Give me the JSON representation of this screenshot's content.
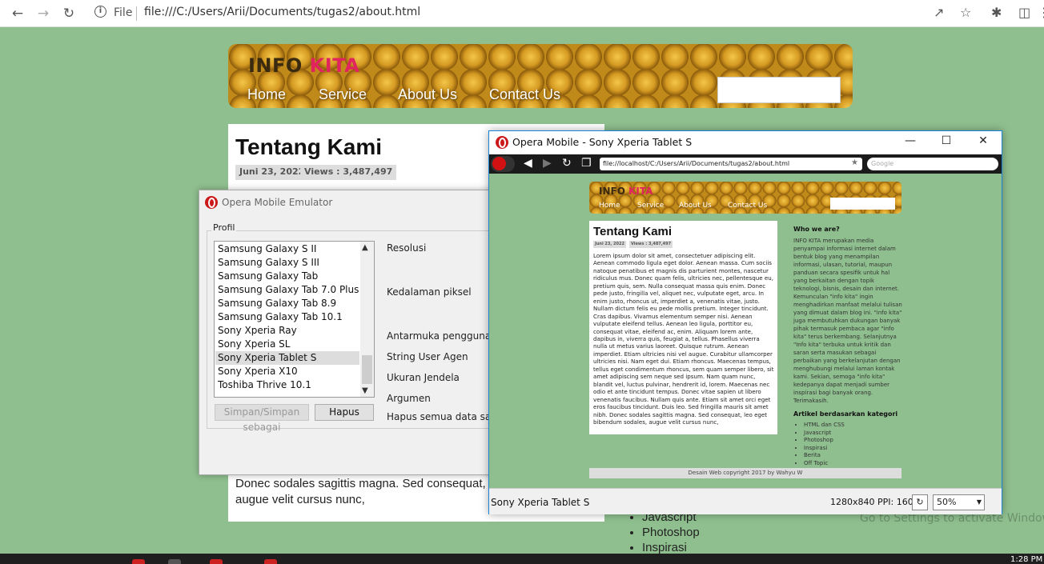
{
  "browser": {
    "file_label": "File",
    "url": "file:///C:/Users/Arii/Documents/tugas2/about.html"
  },
  "page": {
    "logo_a": "INFO",
    "logo_b": "KITA",
    "nav": [
      "Home",
      "Service",
      "About Us",
      "Contact Us"
    ],
    "title": "Tentang Kami",
    "date": "Juni 23, 2022",
    "views": "Views : 3,487,497",
    "body_tail": "Donec sodales sagittis magna. Sed consequat, leo sodales, augue velit cursus nunc,",
    "list_tail": [
      "Javascript",
      "Photoshop",
      "Inspirasi"
    ],
    "watermark": "Go to Settings to activate Windows."
  },
  "emulator": {
    "title": "Opera Mobile Emulator",
    "profile_label": "Profil",
    "devices": [
      "Samsung Galaxy S II",
      "Samsung Galaxy S III",
      "Samsung Galaxy Tab",
      "Samsung Galaxy Tab 7.0 Plus",
      "Samsung Galaxy Tab 8.9",
      "Samsung Galaxy Tab 10.1",
      "Sony Xperia Ray",
      "Sony Xperia SL",
      "Sony Xperia Tablet S",
      "Sony Xperia X10",
      "Toshiba Thrive 10.1"
    ],
    "selected_device": "Sony Xperia Tablet S",
    "props": [
      "Resolusi",
      "Kedalaman piksel",
      "Antarmuka pengguna",
      "String User Agen",
      "Ukuran Jendela",
      "Argumen",
      "Hapus semua data saat me"
    ],
    "save_button": "Simpan/Simpan sebagai",
    "delete_button": "Hapus"
  },
  "mobile": {
    "title": "Opera Mobile - Sony Xperia Tablet S",
    "url": "file://localhost/C:/Users/Arii/Documents/tugas2/about.html",
    "search_placeholder": "Google",
    "device": "Sony Xperia Tablet S",
    "resolution": "1280x840 PPI: 160",
    "zoom": "50%",
    "body_text": "Lorem ipsum dolor sit amet, consectetuer adipiscing elit. Aenean commodo ligula eget dolor. Aenean massa. Cum sociis natoque penatibus et magnis dis parturient montes, nascetur ridiculus mus. Donec quam felis, ultricies nec, pellentesque eu, pretium quis, sem. Nulla consequat massa quis enim. Donec pede justo, fringilla vel, aliquet nec, vulputate eget, arcu. In enim justo, rhoncus ut, imperdiet a, venenatis vitae, justo. Nullam dictum felis eu pede mollis pretium. Integer tincidunt. Cras dapibus. Vivamus elementum semper nisi. Aenean vulputate eleifend tellus. Aenean leo ligula, porttitor eu, consequat vitae, eleifend ac, enim. Aliquam lorem ante, dapibus in, viverra quis, feugiat a, tellus. Phasellus viverra nulla ut metus varius laoreet. Quisque rutrum. Aenean imperdiet. Etiam ultricies nisi vel augue. Curabitur ullamcorper ultricies nisi. Nam eget dui. Etiam rhoncus. Maecenas tempus, tellus eget condimentum rhoncus, sem quam semper libero, sit amet adipiscing sem neque sed ipsum. Nam quam nunc, blandit vel, luctus pulvinar, hendrerit id, lorem. Maecenas nec odio et ante tincidunt tempus. Donec vitae sapien ut libero venenatis faucibus. Nullam quis ante. Etiam sit amet orci eget eros faucibus tincidunt. Duis leo. Sed fringilla mauris sit amet nibh. Donec sodales sagittis magna. Sed consequat, leo eget bibendum sodales, augue velit cursus nunc,",
    "side_heading": "Who we are?",
    "side_text": "INFO KITA merupakan media penyampai informasi internet dalam bentuk blog yang menampilan informasi, ulasan, tutorial, maupun panduan secara spesifik untuk hal yang berkaitan dengan topik teknologi, bisnis, desain dan internet. Kemunculan \"info kita\" ingin menghadirkan manfaat melalui tulisan yang dimuat dalam blog ini. \"info kita\" juga membutuhkan dukungan banyak pihak termasuk pembaca agar \"info kita\" terus berkembang. Selanjutnya \"Info kita\" terbuka untuk kritik dan saran serta masukan sebagai perbaikan yang berkelanjutan dengan menghubungi melalui laman kontak kami. Sekian, semoga \"info kita\" kedepanya dapat menjadi sumber inspirasi bagi banyak orang. Terimakasih.",
    "category_heading": "Artikel berdasarkan kategori",
    "categories": [
      "HTML dan CSS",
      "Javascript",
      "Photoshop",
      "Inspirasi",
      "Berita",
      "Off Topic"
    ],
    "footer": "Desain Web copyright 2017 by Wahyu W"
  },
  "taskbar": {
    "clock": "1:28 PM"
  }
}
